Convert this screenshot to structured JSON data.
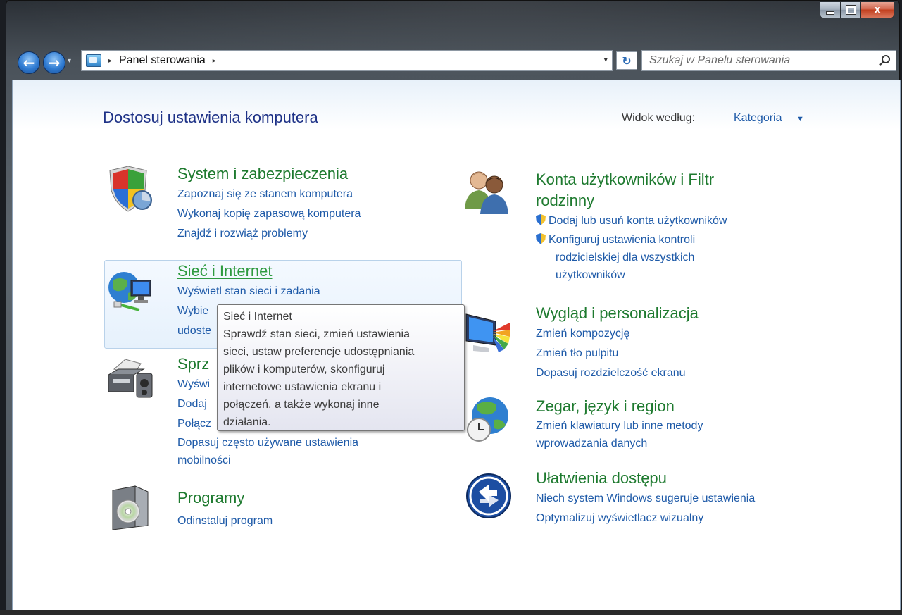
{
  "window": {
    "controls": {
      "minimize": "minimize",
      "maximize": "maximize",
      "close": "x"
    }
  },
  "addressbar": {
    "breadcrumb_sep": "▸",
    "crumb": "Panel sterowania",
    "trailing_sep": "▸",
    "dropdown": "▾",
    "refresh": "↻",
    "back": "←",
    "forward": "→",
    "history": "▾"
  },
  "search": {
    "placeholder": "Szukaj w Panelu sterowania"
  },
  "page": {
    "title": "Dostosuj ustawienia komputera",
    "view_by_label": "Widok według:",
    "view_by_value": "Kategoria",
    "view_by_arrow": "▼"
  },
  "categories": {
    "system": {
      "title": "System i zabezpieczenia",
      "links": [
        "Zapoznaj się ze stanem komputera",
        "Wykonaj kopię zapasową komputera",
        "Znajdź i rozwiąż problemy"
      ],
      "icon": "shield-icon"
    },
    "network": {
      "title": "Sieć i Internet",
      "links": [
        "Wyświetl stan sieci i zadania",
        "Wybie",
        "udoste"
      ],
      "icon": "network-icon"
    },
    "hardware": {
      "title": "Sprz",
      "links": [
        "Wyświ",
        "Dodaj",
        "Połącz",
        "Dopasuj często używane ustawienia",
        "mobilności"
      ],
      "icon": "printer-icon"
    },
    "programs": {
      "title": "Programy",
      "links": [
        "Odinstaluj program"
      ],
      "icon": "programs-icon"
    },
    "accounts": {
      "title_line1": "Konta użytkowników i Filtr",
      "title_line2": "rodzinny",
      "links": [
        "Dodaj lub usuń konta użytkowników",
        "Konfiguruj ustawienia kontroli",
        "rodzicielskiej dla wszystkich",
        "użytkowników"
      ],
      "icon": "users-icon"
    },
    "appearance": {
      "title": "Wygląd i personalizacja",
      "links": [
        "Zmień kompozycję",
        "Zmień tło pulpitu",
        "Dopasuj rozdzielczość ekranu"
      ],
      "icon": "display-icon"
    },
    "clock": {
      "title": "Zegar, język i region",
      "links": [
        "Zmień klawiatury lub inne metody",
        "wprowadzania danych"
      ],
      "icon": "globe-clock-icon"
    },
    "ease": {
      "title": "Ułatwienia dostępu",
      "links": [
        "Niech system Windows sugeruje ustawienia",
        "Optymalizuj wyświetlacz wizualny"
      ],
      "icon": "ease-of-access-icon"
    }
  },
  "tooltip": {
    "title": "Sieć i Internet",
    "lines": [
      "Sprawdź stan sieci, zmień ustawienia",
      "sieci, ustaw preferencje udostępniania",
      "plików i komputerów, skonfiguruj",
      "internetowe ustawienia ekranu i",
      "połączeń, a także wykonaj inne",
      "działania."
    ]
  }
}
